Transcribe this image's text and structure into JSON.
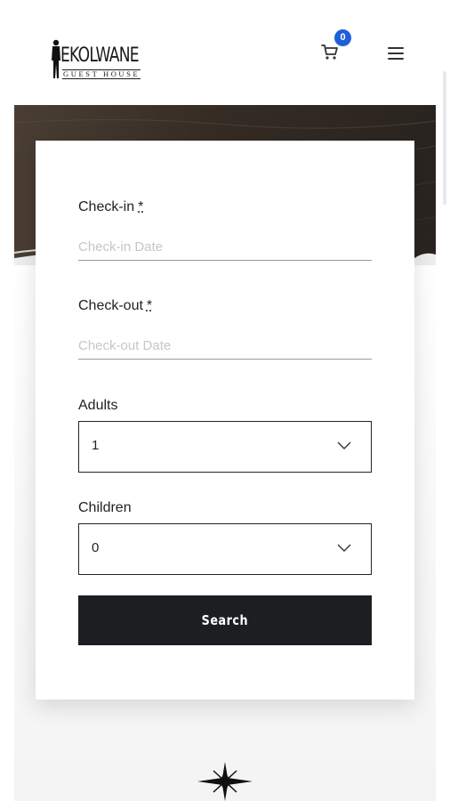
{
  "header": {
    "logo": {
      "wordmark": "EKOLWANE",
      "subtitle": "GUEST HOUSE"
    },
    "cart": {
      "icon": "cart-icon",
      "count": "0"
    },
    "menu": {
      "icon": "hamburger-menu-icon"
    }
  },
  "booking_form": {
    "checkin": {
      "label": "Check-in",
      "required_mark": "*",
      "placeholder": "Check-in Date",
      "value": ""
    },
    "checkout": {
      "label": "Check-out",
      "required_mark": "*",
      "placeholder": "Check-out Date",
      "value": ""
    },
    "adults": {
      "label": "Adults",
      "value": "1"
    },
    "children": {
      "label": "Children",
      "value": "0"
    },
    "search_label": "Search"
  },
  "colors": {
    "badge": "#1e5fd8",
    "button": "#1c1e22",
    "text": "#222222",
    "placeholder": "#c6c6c6"
  },
  "decor": {
    "icon": "star-ornament-icon"
  }
}
